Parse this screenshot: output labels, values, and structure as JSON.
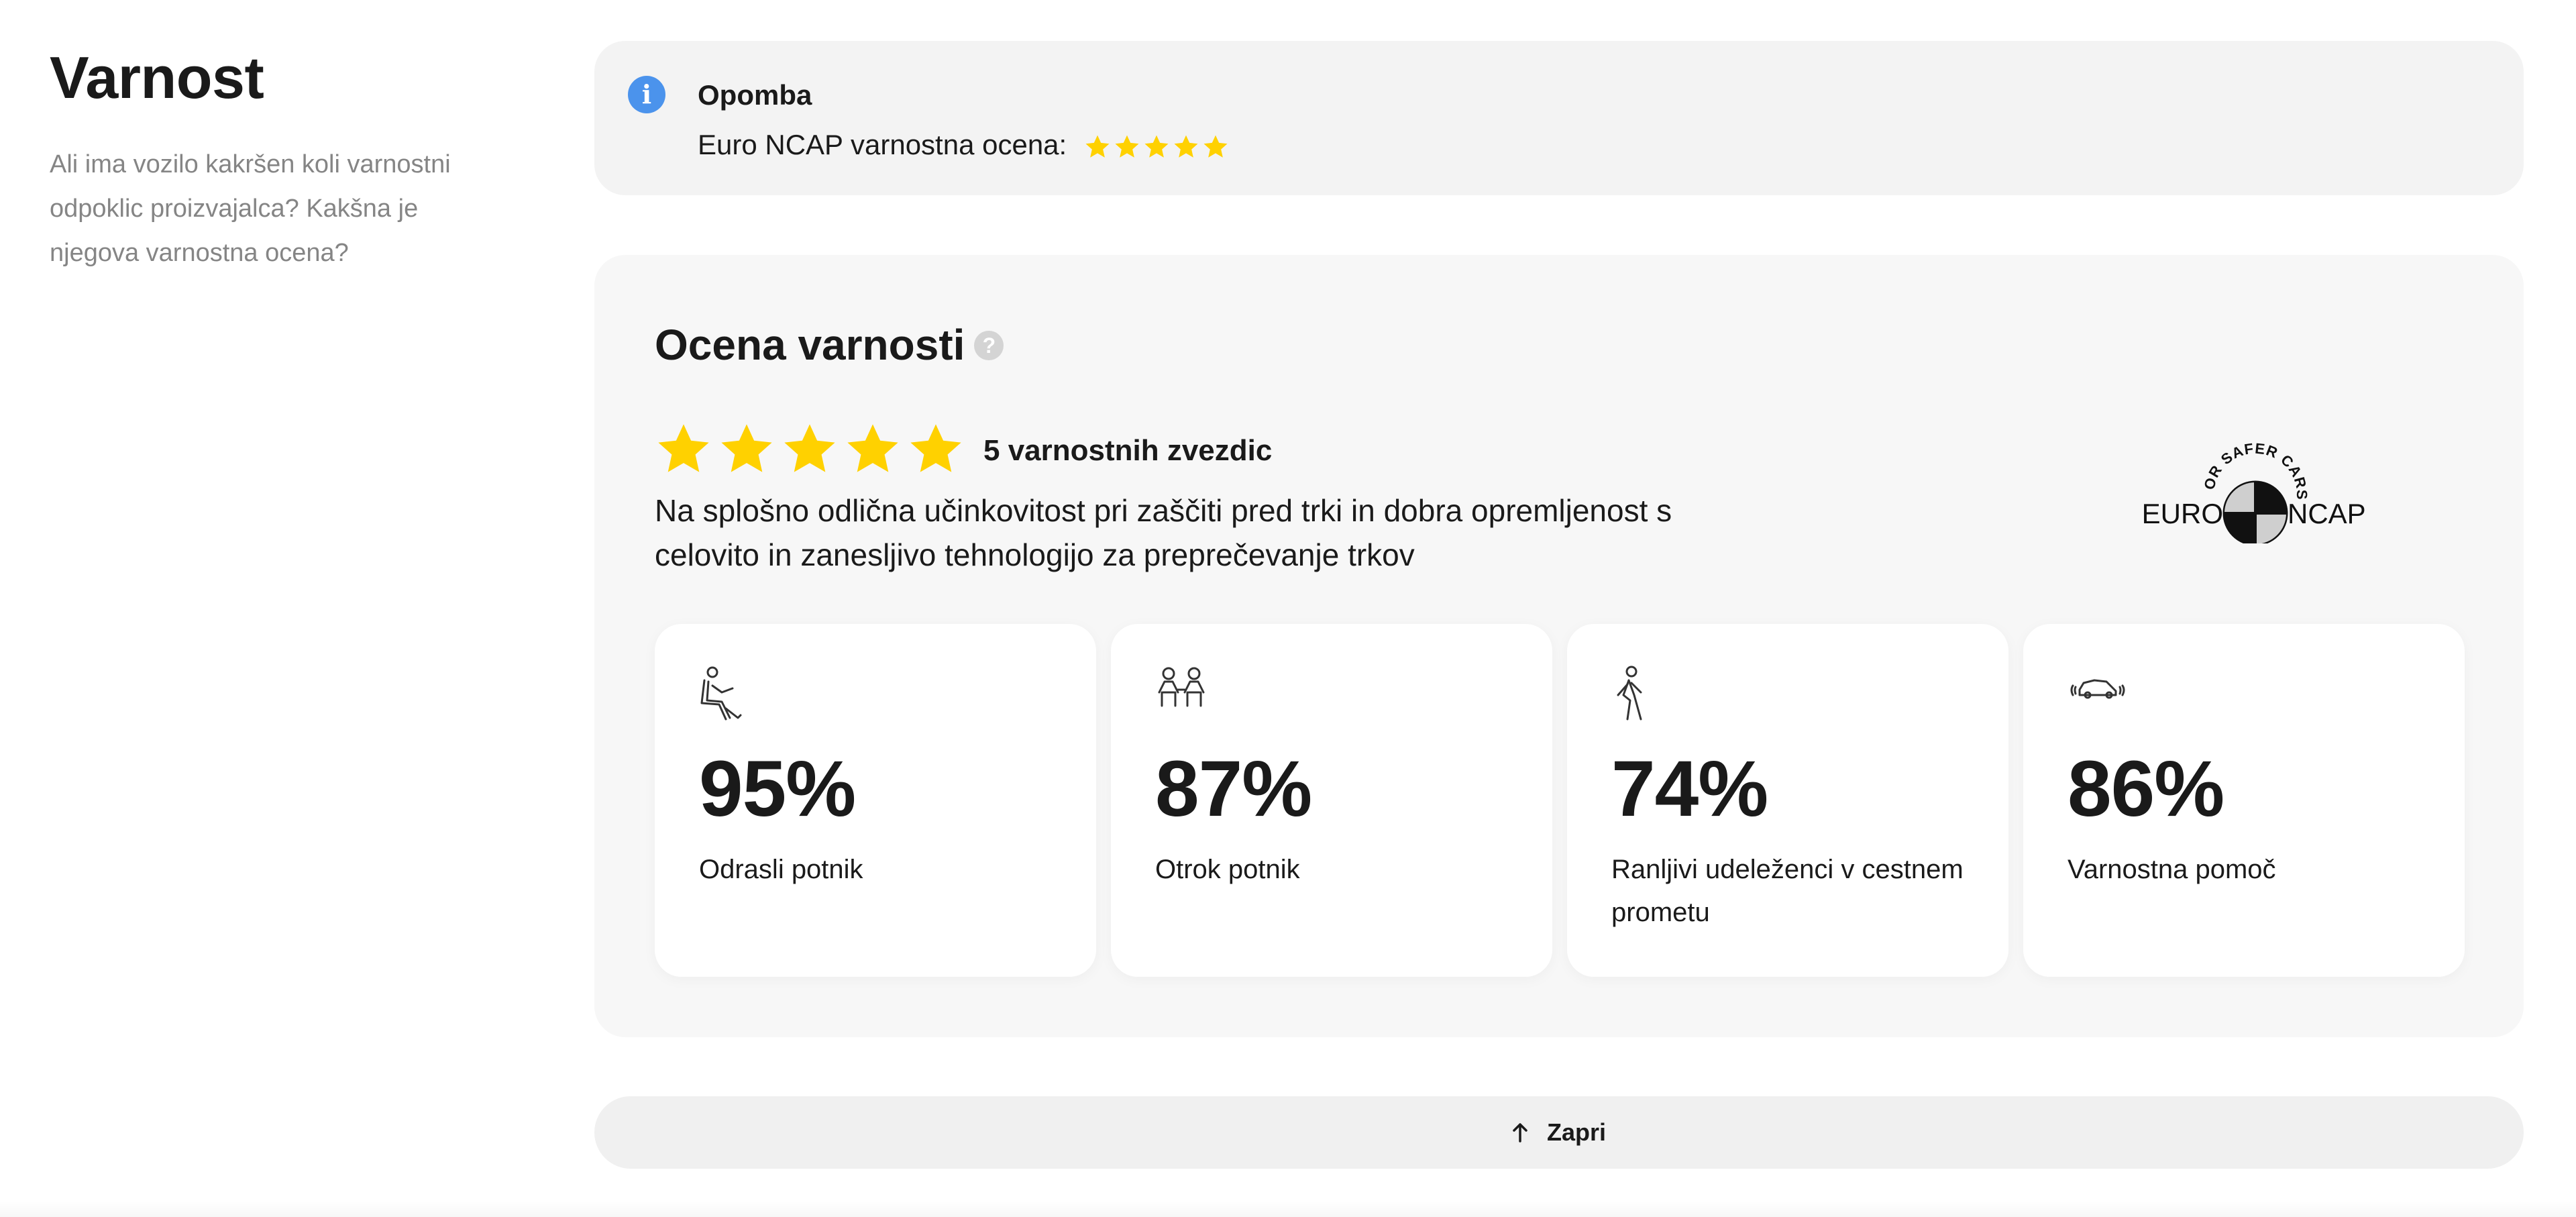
{
  "colors": {
    "star": "#ffd100",
    "info_icon": "#4b93ec",
    "panel_background": "#f7f7f7",
    "note_background": "#f3f3f3",
    "close_background": "#f0f0f0"
  },
  "page": {
    "title": "Varnost",
    "description": "Ali ima vozilo kakršen koli varnostni odpoklic proizvajalca? Kakšna je njegova varnostna ocena?"
  },
  "note": {
    "icon": "info-icon",
    "title": "Opomba",
    "text": "Euro NCAP varnostna ocena:",
    "stars": 5
  },
  "safety": {
    "title": "Ocena varnosti",
    "help_icon": "?",
    "stars": 5,
    "stars_label": "5 varnostnih zvezdic",
    "description": "Na splošno odlična učinkovitost pri zaščiti pred trki in dobra opremljenost s celovito in zanesljivo tehnologijo za preprečevanje trkov",
    "logo": {
      "arc_text": "FOR SAFER CARS",
      "left_text": "EURO",
      "right_text": "NCAP"
    },
    "metrics": [
      {
        "icon": "adult-occupant-icon",
        "value": "95%",
        "label": "Odrasli potnik"
      },
      {
        "icon": "child-occupant-icon",
        "value": "87%",
        "label": "Otrok potnik"
      },
      {
        "icon": "pedestrian-icon",
        "value": "74%",
        "label": "Ranljivi udeleženci v cestnem prometu"
      },
      {
        "icon": "safety-assist-car-icon",
        "value": "86%",
        "label": "Varnostna pomoč"
      }
    ]
  },
  "close": {
    "icon": "arrow-up-icon",
    "label": "Zapri"
  }
}
